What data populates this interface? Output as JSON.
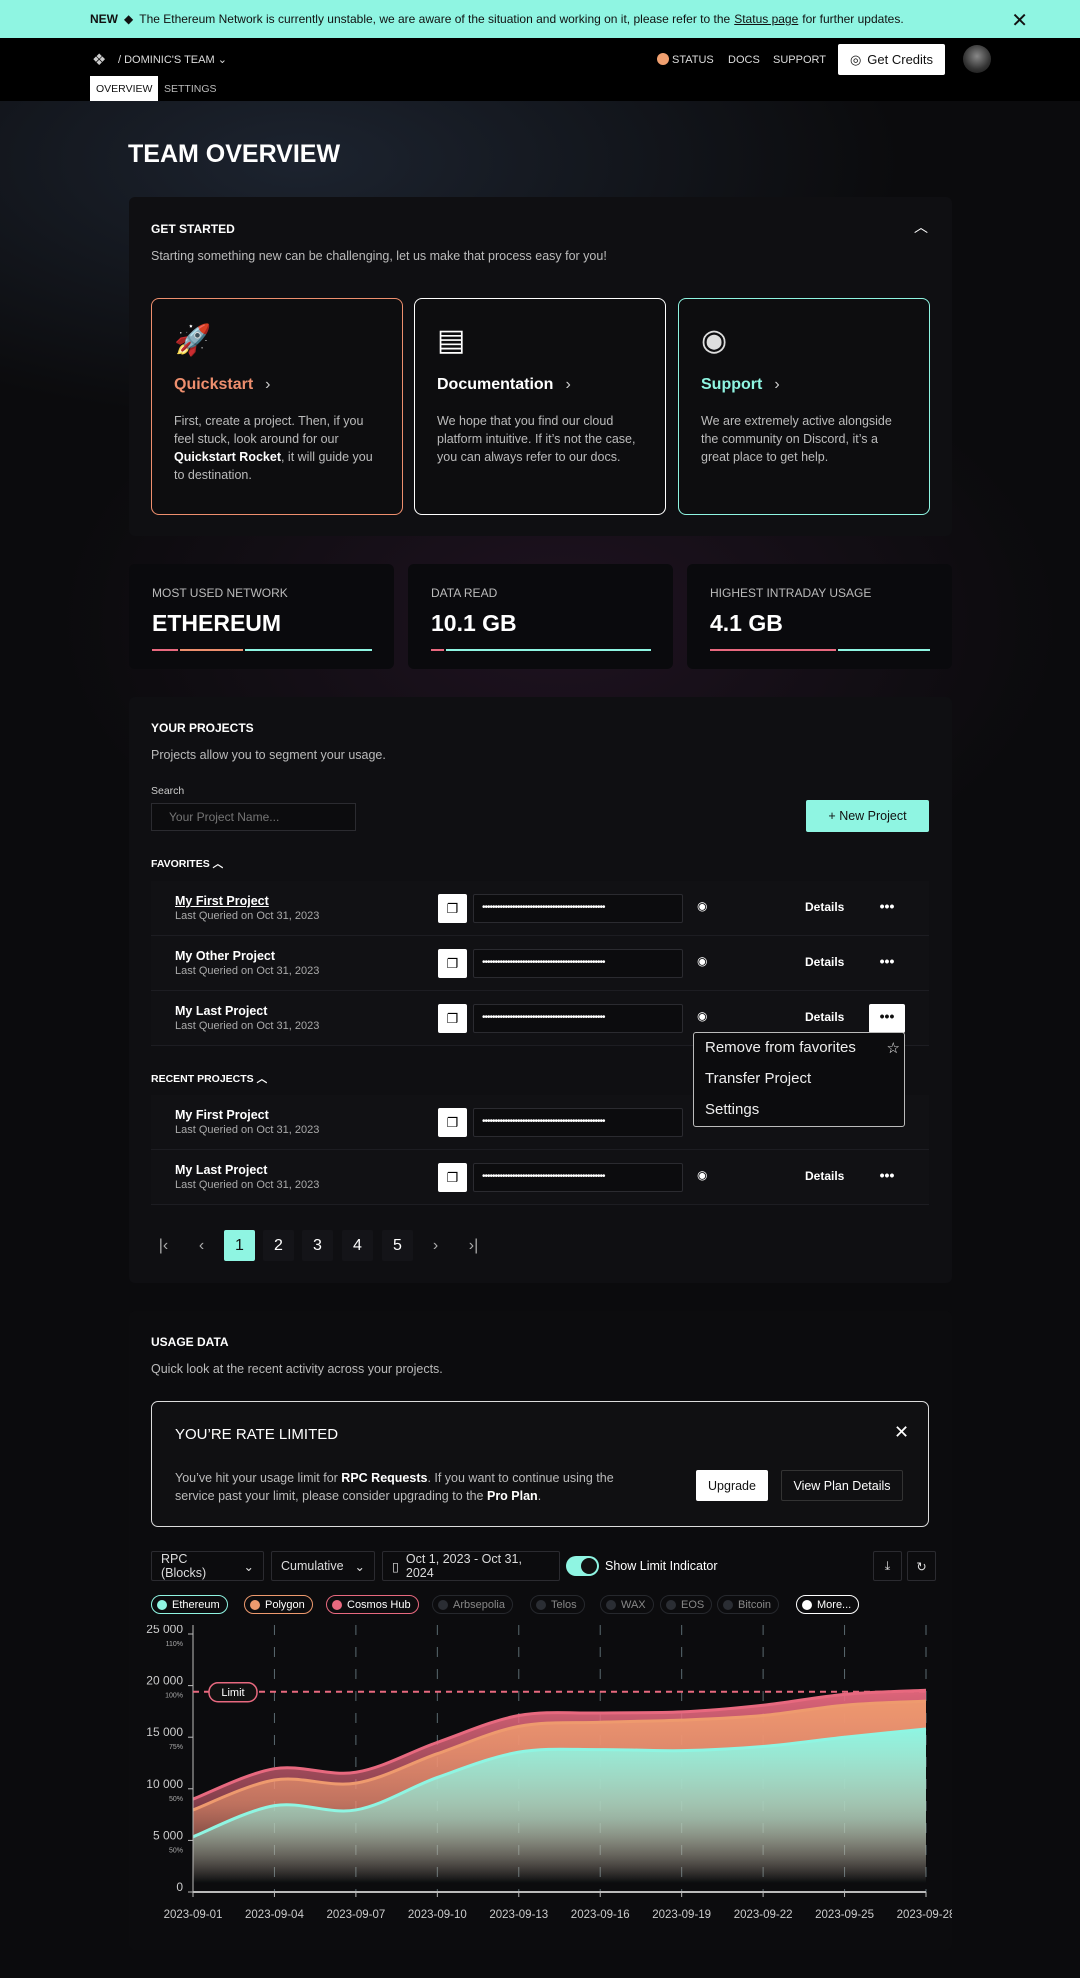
{
  "banner": {
    "tag": "NEW",
    "text_before": "The Ethereum Network is currently unstable, we are aware of the situation and working on it, please refer to the",
    "link": "Status page",
    "text_after": "for further updates."
  },
  "header": {
    "team": "/ DOMINIC'S TEAM",
    "status": "STATUS",
    "docs": "DOCS",
    "support": "SUPPORT",
    "get_credits": "Get Credits",
    "tabs": [
      "OVERVIEW",
      "SETTINGS"
    ],
    "status_color": "#f0a070"
  },
  "page_title": "TEAM OVERVIEW",
  "get_started": {
    "title": "GET STARTED",
    "subtitle": "Starting something new can be challenging, let us make that process easy for you!",
    "cards": [
      {
        "title": "Quickstart",
        "icon": "rocket-icon",
        "color": "#ee8f6e",
        "text_parts": [
          "First, create a project. Then, if you feel stuck, look around for our ",
          "Quickstart Rocket",
          ", it will guide you to destination."
        ]
      },
      {
        "title": "Documentation",
        "icon": "book-icon",
        "color": "#ffffff",
        "text_parts": [
          "We hope that you find our cloud platform intuitive. If it’s not the case, you can always refer to our docs."
        ]
      },
      {
        "title": "Support",
        "icon": "discord-icon",
        "color": "#8ff5e2",
        "text_parts": [
          "We are extremely active alongside the community on Discord, it’s a great place to get help."
        ]
      }
    ]
  },
  "stats": [
    {
      "label": "MOST USED NETWORK",
      "value": "ETHEREUM",
      "bar": [
        {
          "color": "#e8697f",
          "frac": 0.12
        },
        {
          "color": "#ee8f6e",
          "frac": 0.29
        },
        {
          "color": "#8ff5e2",
          "frac": 0.59
        }
      ]
    },
    {
      "label": "DATA READ",
      "value": "10.1 GB",
      "bar": [
        {
          "color": "#e8697f",
          "frac": 0.06
        },
        {
          "color": "#8ff5e2",
          "frac": 0.94
        }
      ]
    },
    {
      "label": "HIGHEST INTRADAY USAGE",
      "value": "4.1 GB",
      "bar": [
        {
          "color": "#e8697f",
          "frac": 0.58
        },
        {
          "color": "#8ff5e2",
          "frac": 0.42
        }
      ]
    }
  ],
  "projects": {
    "title": "YOUR PROJECTS",
    "subtitle": "Projects allow you to segment your usage.",
    "search_label": "Search",
    "search_placeholder": "Your Project Name...",
    "new_project": "+ New Project",
    "favorites_label": "FAVORITES",
    "recent_label": "RECENT PROJECTS",
    "details": "Details",
    "key_mask": "•••••••••••••••••••••••••••••••••••••••••••••••••",
    "favorites": [
      {
        "name": "My First Project",
        "date": "Last Queried on Oct 31, 2023"
      },
      {
        "name": "My Other Project",
        "date": "Last Queried on Oct 31, 2023"
      },
      {
        "name": "My Last Project",
        "date": "Last Queried on Oct 31, 2023"
      }
    ],
    "recent": [
      {
        "name": "My First Project",
        "date": "Last Queried on Oct 31, 2023"
      },
      {
        "name": "My Last Project",
        "date": "Last Queried on Oct 31, 2023"
      }
    ],
    "menu": [
      "Remove from favorites",
      "Transfer Project",
      "Settings"
    ],
    "pages": [
      "1",
      "2",
      "3",
      "4",
      "5"
    ],
    "current_page": "1"
  },
  "usage": {
    "title": "USAGE DATA",
    "subtitle": "Quick look at the recent activity across your projects.",
    "alert": {
      "title": "YOU’RE RATE LIMITED",
      "parts": [
        "You’ve hit your usage limit for ",
        "RPC Requests",
        ". If you want to continue using the service past your limit, please consider upgrading to the ",
        "Pro Plan",
        "."
      ],
      "upgrade": "Upgrade",
      "view_plan": "View Plan Details"
    },
    "metric": "RPC (Blocks)",
    "mode": "Cumulative",
    "date_range": "Oct 1, 2023 - Oct 31, 2024",
    "show_limit": "Show Limit Indicator",
    "show_limit_on": true,
    "networks": [
      {
        "name": "Ethereum",
        "color": "#8ff5e2",
        "active": true
      },
      {
        "name": "Polygon",
        "color": "#ee9a6e",
        "active": true
      },
      {
        "name": "Cosmos Hub",
        "color": "#e8697f",
        "active": true
      },
      {
        "name": "Arbsepolia",
        "color": "#2a2d33",
        "active": false
      },
      {
        "name": "Telos",
        "color": "#2a2d33",
        "active": false
      },
      {
        "name": "WAX",
        "color": "#2a2d33",
        "active": false
      },
      {
        "name": "EOS",
        "color": "#2a2d33",
        "active": false
      },
      {
        "name": "Bitcoin",
        "color": "#2a2d33",
        "active": false
      },
      {
        "name": "More...",
        "color": "#ffffff",
        "active": true
      }
    ]
  },
  "chart_data": {
    "type": "area",
    "stacked": true,
    "x": [
      "2023-09-01",
      "2023-09-04",
      "2023-09-07",
      "2023-09-10",
      "2023-09-13",
      "2023-09-16",
      "2023-09-19",
      "2023-09-22",
      "2023-09-25",
      "2023-09-28"
    ],
    "series": [
      {
        "name": "Ethereum",
        "color": "#8ff5e2",
        "values": [
          5350,
          8370,
          7950,
          11100,
          13550,
          13800,
          13700,
          14100,
          15000,
          15800
        ]
      },
      {
        "name": "Polygon",
        "color": "#ee9a6e",
        "values": [
          2600,
          2480,
          2600,
          2300,
          2500,
          2650,
          2950,
          3000,
          3100,
          2700
        ]
      },
      {
        "name": "Cosmos Hub",
        "color": "#e8697f",
        "values": [
          1050,
          1100,
          1050,
          1100,
          1050,
          900,
          800,
          1000,
          1050,
          1050
        ]
      }
    ],
    "yticks": [
      {
        "v": 0,
        "label": "0",
        "pct": ""
      },
      {
        "v": 5000,
        "label": "5 000",
        "pct": "50%"
      },
      {
        "v": 10000,
        "label": "10 000",
        "pct": "50%"
      },
      {
        "v": 15000,
        "label": "15 000",
        "pct": "75%"
      },
      {
        "v": 20000,
        "label": "20 000",
        "pct": "100%"
      },
      {
        "v": 25000,
        "label": "25 000",
        "pct": "110%"
      }
    ],
    "ylim": [
      0,
      25000
    ],
    "limit": {
      "value": 19400,
      "label": "Limit",
      "color": "#e8697f"
    },
    "grid": "vertical-dashed"
  }
}
